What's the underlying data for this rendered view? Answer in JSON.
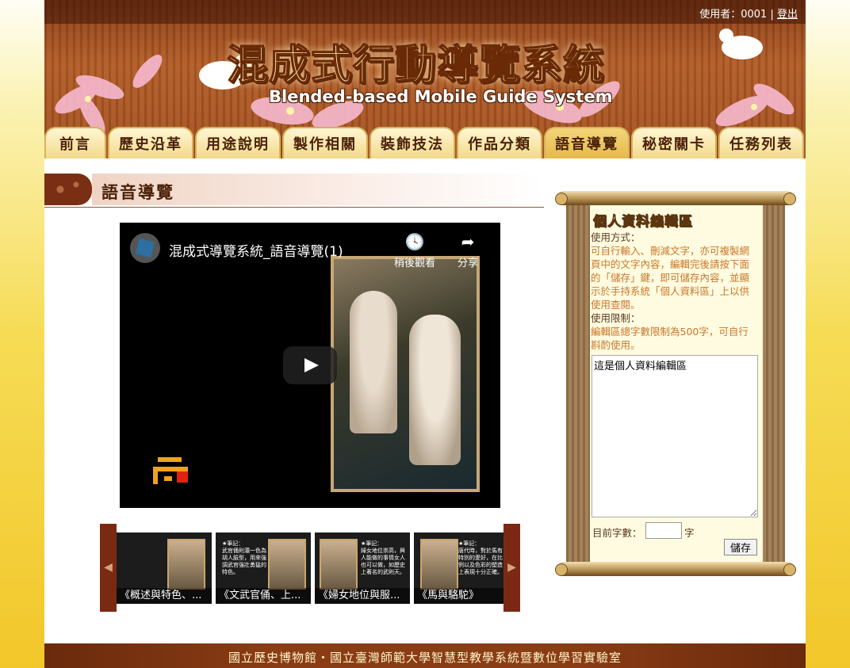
{
  "header": {
    "user_label": "使用者：",
    "user_id": "0001",
    "separator": "|",
    "logout_label": "登出",
    "title_cn": "混成式行動導覽系統",
    "title_en": "Blended-based Mobile Guide System"
  },
  "nav": {
    "tabs": [
      {
        "label": "前言"
      },
      {
        "label": "歷史沿革"
      },
      {
        "label": "用途說明"
      },
      {
        "label": "製作相關"
      },
      {
        "label": "裝飾技法"
      },
      {
        "label": "作品分類"
      },
      {
        "label": "語音導覽",
        "active": true
      },
      {
        "label": "秘密關卡"
      },
      {
        "label": "任務列表"
      }
    ]
  },
  "main": {
    "section_title": "語音導覽",
    "video": {
      "title": "混成式導覽系統_語音導覽(1)",
      "watch_later": "稍後觀看",
      "share": "分享"
    },
    "carousel": {
      "prev_glyph": "◀",
      "next_glyph": "▶",
      "items": [
        {
          "caption": "《概述與特色、..."
        },
        {
          "caption": "《文武官俑、上..."
        },
        {
          "caption": "《婦女地位與服..."
        },
        {
          "caption": "《馬與駱駝》"
        }
      ],
      "card_notes": [
        "★筆記：",
        "武官俑則濃一色為胡人臉型，用來強調武官強壯勇猛的特色。",
        "★筆記：",
        "婦女地位崇高，與人能做的事情女人也可以做，如歷史上著名的武則天。",
        "★筆記：",
        "唐代時，對於馬有特別的愛好，在比例以及色彩的塑造上表現十分正確。"
      ]
    }
  },
  "panel": {
    "title": "個人資料編輯區",
    "usage_label": "使用方式：",
    "usage_text": "可自行輸入、刪減文字，亦可複製網頁中的文字內容，編輯完後請按下面的「儲存」鍵，即可儲存內容，並顯示於手持系統「個人資料區」上以供使用查閱。",
    "limit_label": "使用限制：",
    "limit_text": "編輯區總字數限制為500字，可自行斟酌使用。",
    "textarea_value": "這是個人資料編輯區",
    "count_label": "目前字數：",
    "count_value": "",
    "count_unit": "字",
    "save_label": "儲存"
  },
  "footer": {
    "text": "國立歷史博物館・國立臺灣師範大學智慧型教學系統暨數位學習實驗室"
  }
}
